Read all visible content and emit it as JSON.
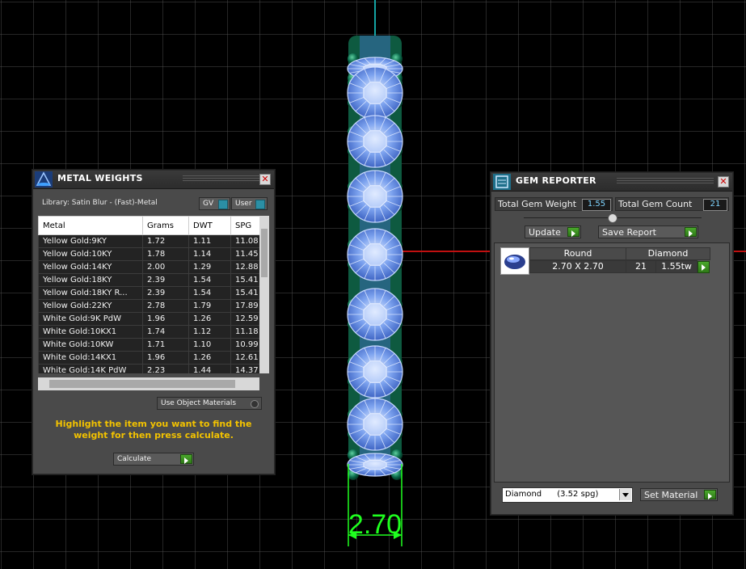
{
  "metal_weights": {
    "title": "METAL WEIGHTS",
    "library_label": "Library: Satin Blur - (Fast)-Metal",
    "gv_label": "GV",
    "user_label": "User",
    "columns": [
      "Metal",
      "Grams",
      "DWT",
      "SPG"
    ],
    "rows": [
      [
        "Yellow Gold:9KY",
        "1.72",
        "1.11",
        "11.08"
      ],
      [
        "Yellow Gold:10KY",
        "1.78",
        "1.14",
        "11.45"
      ],
      [
        "Yellow Gold:14KY",
        "2.00",
        "1.29",
        "12.88"
      ],
      [
        "Yellow Gold:18KY",
        "2.39",
        "1.54",
        "15.41"
      ],
      [
        "Yellow Gold:18KY R...",
        "2.39",
        "1.54",
        "15.41"
      ],
      [
        "Yellow Gold:22KY",
        "2.78",
        "1.79",
        "17.89"
      ],
      [
        "White Gold:9K PdW",
        "1.96",
        "1.26",
        "12.59"
      ],
      [
        "White Gold:10KX1",
        "1.74",
        "1.12",
        "11.18"
      ],
      [
        "White Gold:10KW",
        "1.71",
        "1.10",
        "10.99"
      ],
      [
        "White Gold:14KX1",
        "1.96",
        "1.26",
        "12.61"
      ],
      [
        "White Gold:14K PdW",
        "2.23",
        "1.44",
        "14.37"
      ]
    ],
    "use_object_materials_label": "Use Object Materials",
    "hint_text": "Highlight the item you want to find the weight for then press calculate.",
    "calculate_label": "Calculate"
  },
  "gem_reporter": {
    "title": "GEM REPORTER",
    "total_weight_label": "Total Gem Weight",
    "total_weight_value": "1.55",
    "total_count_label": "Total Gem Count",
    "total_count_value": "21",
    "update_label": "Update",
    "save_report_label": "Save Report",
    "gem_row": {
      "shape": "Round",
      "size": "2.70 X 2.70",
      "material": "Diamond",
      "count": "21",
      "tw": "1.55tw"
    },
    "material_select": "Diamond      (3.52 spg)",
    "set_material_label": "Set Material"
  },
  "viewport": {
    "dimension_label": "2.70"
  },
  "colors": {
    "grid": "#4d4d4d",
    "panel_bg": "#4a4a4a",
    "hint_yellow": "#f2c200",
    "gem_blue": "#8fb4f5",
    "prong_green": "#0b6a4c",
    "dim_green": "#1fff1f",
    "axis_red": "#c01010",
    "axis_teal": "#14a3a3"
  }
}
